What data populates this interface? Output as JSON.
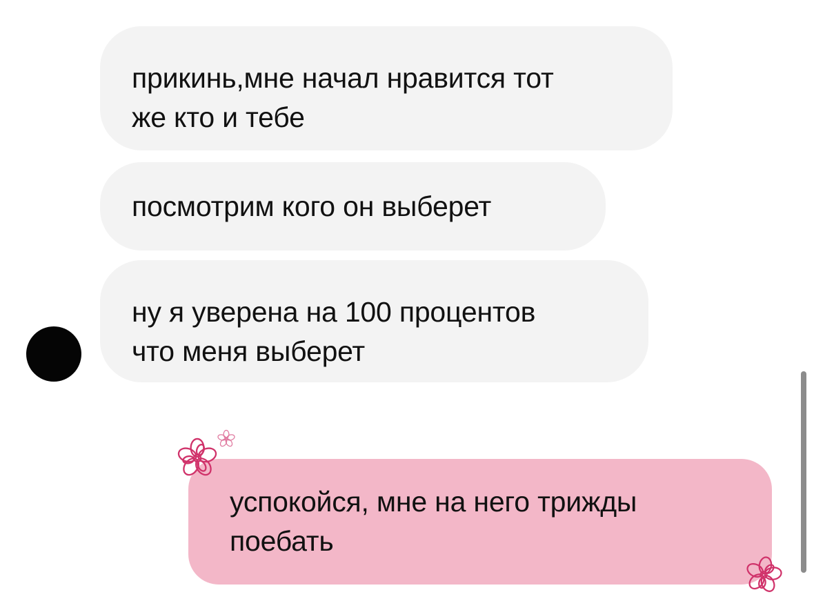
{
  "messages": [
    {
      "id": "m1",
      "direction": "incoming",
      "text": "прикинь,мне начал нравится тот\nже кто и тебе"
    },
    {
      "id": "m2",
      "direction": "incoming",
      "text": "посмотрим кого он выберет"
    },
    {
      "id": "m3",
      "direction": "incoming",
      "text": "ну я уверена на 100 процентов\nчто меня выберет"
    },
    {
      "id": "m4",
      "direction": "outgoing",
      "text": "успокойся, мне на него трижды\nпоебать"
    }
  ],
  "colors": {
    "incoming_bubble": "#f3f3f3",
    "outgoing_bubble": "#f3b7c8",
    "flower_stroke": "#d0326a",
    "avatar": "#050505"
  },
  "icons": {
    "avatar": "contact-avatar",
    "sticker_main": "flower-icon",
    "sticker_small": "flower-icon",
    "sticker_corner": "flower-icon"
  }
}
